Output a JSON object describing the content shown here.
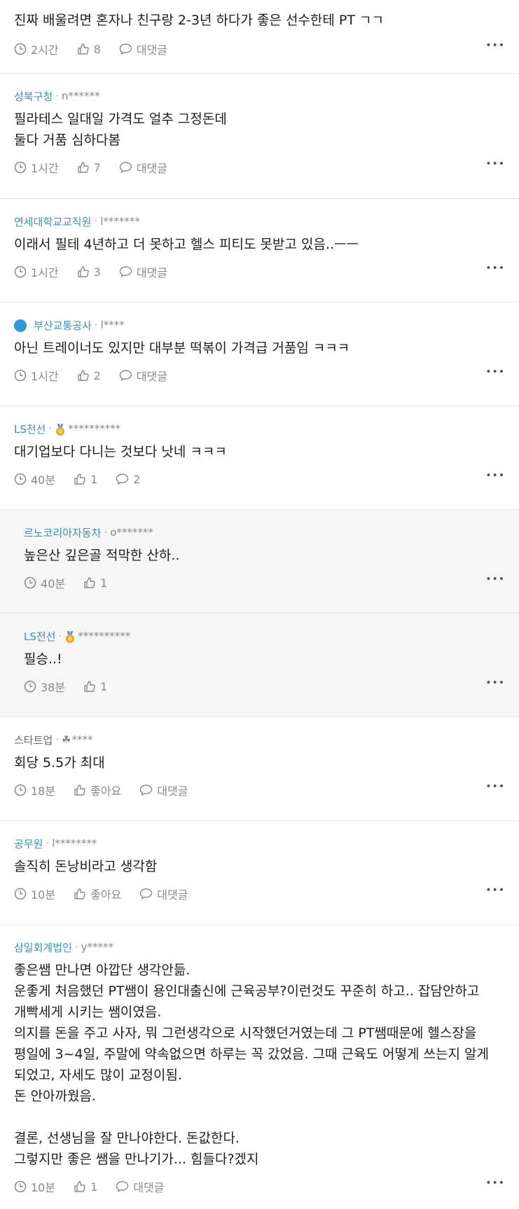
{
  "comments": [
    {
      "company": "",
      "uid": "",
      "text": "진짜 배울려면 혼자나 친구랑 2-3년 하다가 좋은 선수한테 PT ㄱㄱ",
      "time": "2시간",
      "likes": "8",
      "reply": "대댓글"
    },
    {
      "company": "성북구청",
      "uid": "n******",
      "text": "필라테스 일대일 가격도 얼추 그정돈데\n둘다 거품 심하다봄",
      "time": "1시간",
      "likes": "7",
      "reply": "대댓글"
    },
    {
      "company": "연세대학교교직원",
      "uid": "l*******",
      "text": "이래서 필테 4년하고 더 못하고 헬스 피티도 못받고 있음..ㅡㅡ",
      "time": "1시간",
      "likes": "3",
      "reply": "대댓글"
    },
    {
      "company": "부산교통공사",
      "uid": "l****",
      "text": "아닌 트레이너도 있지만 대부분 떡볶이 가격급 거품임 ㅋㅋㅋ",
      "time": "1시간",
      "likes": "2",
      "reply": "대댓글"
    },
    {
      "company": "LS전선",
      "uid": "**********",
      "text": "대기업보다 다니는 것보다 낫네 ㅋㅋㅋ",
      "time": "40분",
      "likes": "1",
      "reply": "2"
    },
    {
      "company": "르노코리아자동차",
      "uid": "o*******",
      "text": "높은산 깊은골 적막한 산하..",
      "time": "40분",
      "likes": "1"
    },
    {
      "company": "LS전선",
      "uid": "**********",
      "text": "필승..!",
      "time": "38분",
      "likes": "1"
    },
    {
      "company": "스타트업",
      "uid": "****",
      "text": "회당 5.5가 최대",
      "time": "18분",
      "likes": "좋아요",
      "reply": "대댓글"
    },
    {
      "company": "공무원",
      "uid": "l********",
      "text": "솔직히 돈낭비라고 생각함",
      "time": "10분",
      "likes": "좋아요",
      "reply": "대댓글"
    },
    {
      "company": "삼일회계법인",
      "uid": "y*****",
      "text": "좋은쌤 만나면 아깝단 생각안듦.\n운좋게 처음했던 PT쌤이 용인대출신에 근육공부?이런것도 꾸준히 하고.. 잡담안하고 개빡세게 시키는 쌤이였음.\n의지를 돈을 주고 사자, 뭐 그런생각으로 시작했던거였는데 그 PT쌤때문에 헬스장을 평일에 3~4일, 주말에 약속없으면 하루는 꼭 갔었음. 그때 근육도 어떻게 쓰는지 알게 되었고, 자세도 많이 교정이됨.\n돈 안아까웠음.\n\n결론, 선생님을 잘 만나야한다. 돈값한다.\n그렇지만 좋은 쌤을 만나기가... 힘들다?겠지",
      "time": "10분",
      "likes": "1",
      "reply": "대댓글"
    }
  ],
  "more_label": "•••"
}
